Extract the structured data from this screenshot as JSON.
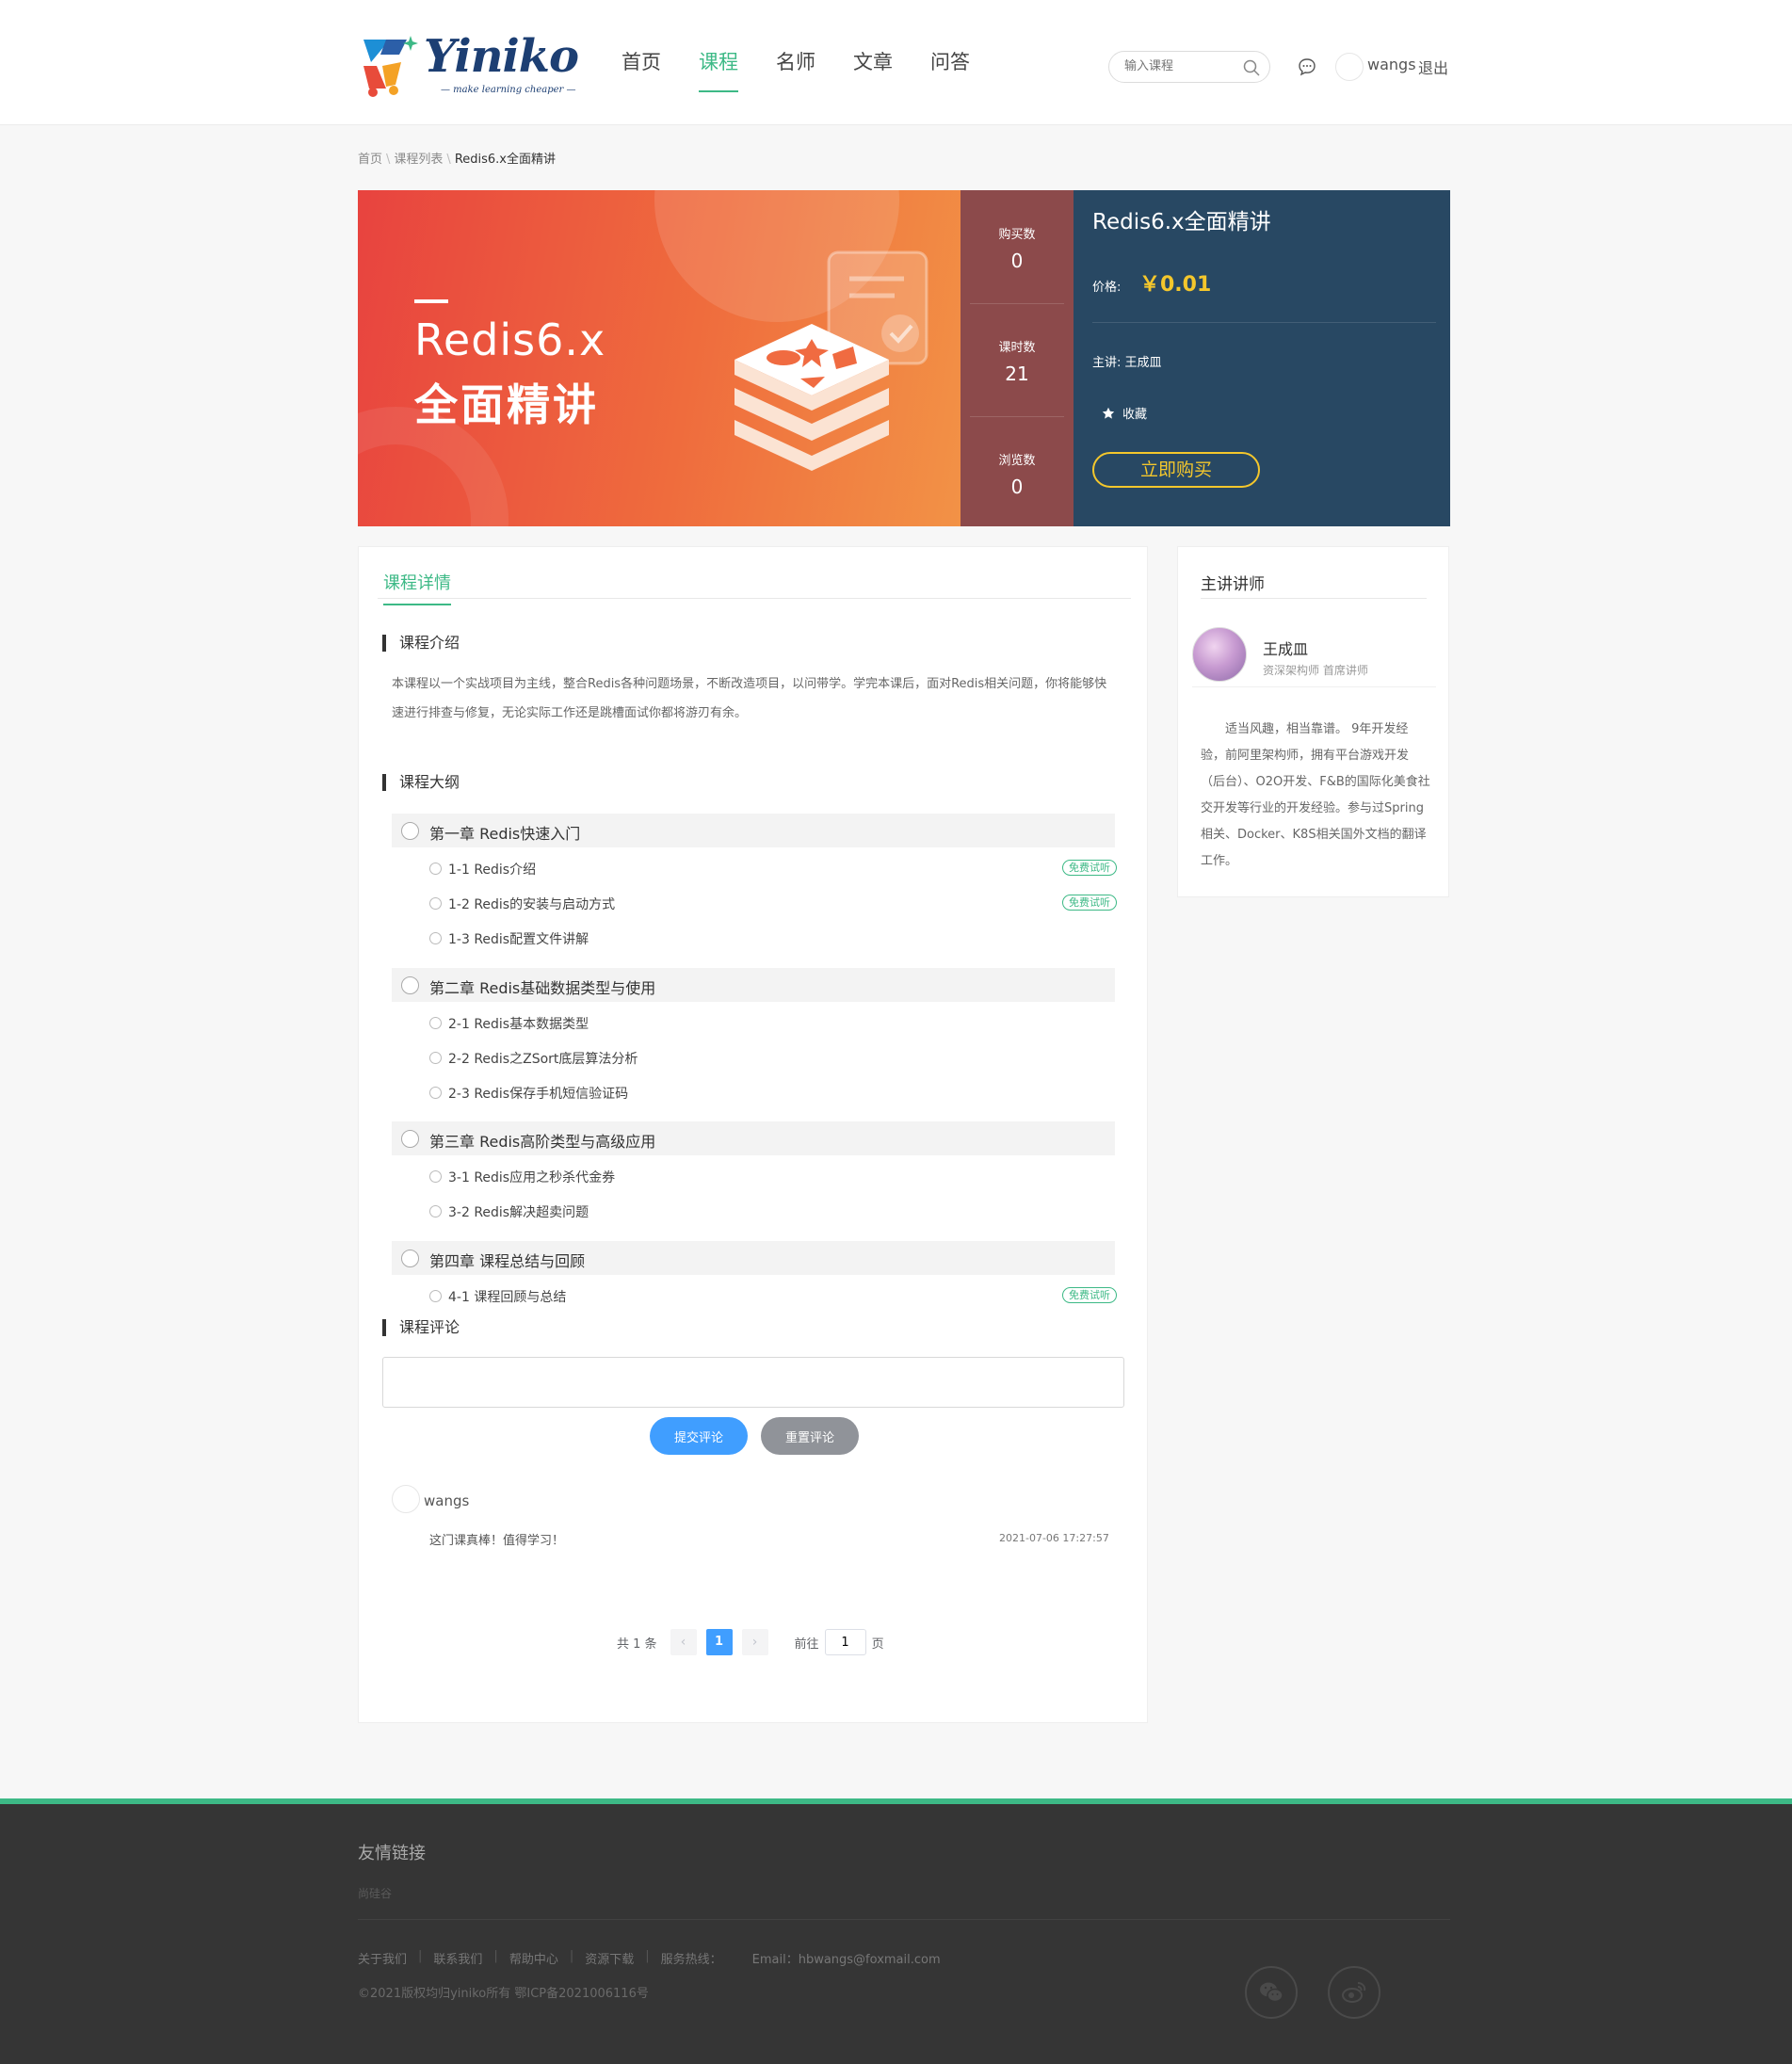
{
  "brand": {
    "logo_text": "Yiniko",
    "tagline": "— make learning cheaper —",
    "accent": "#3db986",
    "navy": "#1d3f73"
  },
  "nav": [
    {
      "label": "首页",
      "active": false
    },
    {
      "label": "课程",
      "active": true
    },
    {
      "label": "名师",
      "active": false
    },
    {
      "label": "文章",
      "active": false
    },
    {
      "label": "问答",
      "active": false
    }
  ],
  "header": {
    "search_placeholder": "输入课程",
    "search_icon": "search-icon",
    "message_icon": "chat-bubble-icon",
    "user": "wangs",
    "logout": "退出"
  },
  "breadcrumb": {
    "home": "首页",
    "list": "课程列表",
    "current": "Redis6.x全面精讲"
  },
  "banner": {
    "line1": "Redis6.x",
    "line2": "全面精讲",
    "gradient": [
      "#e8433f",
      "#f29246"
    ]
  },
  "stats": [
    {
      "label": "购买数",
      "value": "0"
    },
    {
      "label": "课时数",
      "value": "21"
    },
    {
      "label": "浏览数",
      "value": "0"
    }
  ],
  "course": {
    "title": "Redis6.x全面精讲",
    "price_label": "价格:",
    "price": "￥0.01",
    "teacher_label": "主讲:",
    "teacher": "王成皿",
    "favorite": "收藏",
    "buy": "立即购买",
    "panel_color": "#284863",
    "price_color": "#f4c72c"
  },
  "detail": {
    "tab": "课程详情",
    "intro_title": "课程介绍",
    "intro_text": "本课程以一个实战项目为主线，整合Redis各种问题场景，不断改造项目，以问带学。学完本课后，面对Redis相关问题，你将能够快速进行排查与修复，无论实际工作还是跳槽面试你都将游刃有余。",
    "outline_title": "课程大纲",
    "free_label": "免费试听",
    "chapters": [
      {
        "label": "第一章 Redis快速入门",
        "lessons": [
          {
            "label": "1-1 Redis介绍",
            "free": true
          },
          {
            "label": "1-2 Redis的安装与启动方式",
            "free": true
          },
          {
            "label": "1-3 Redis配置文件讲解",
            "free": false
          }
        ]
      },
      {
        "label": "第二章 Redis基础数据类型与使用",
        "lessons": [
          {
            "label": "2-1 Redis基本数据类型",
            "free": false
          },
          {
            "label": "2-2 Redis之ZSort底层算法分析",
            "free": false
          },
          {
            "label": "2-3 Redis保存手机短信验证码",
            "free": false
          }
        ]
      },
      {
        "label": "第三章 Redis高阶类型与高级应用",
        "lessons": [
          {
            "label": "3-1 Redis应用之秒杀代金券",
            "free": false
          },
          {
            "label": "3-2 Redis解决超卖问题",
            "free": false
          }
        ]
      },
      {
        "label": "第四章 课程总结与回顾",
        "lessons": [
          {
            "label": "4-1 课程回顾与总结",
            "free": true
          }
        ]
      }
    ],
    "comment_title": "课程评论",
    "comment_value": "",
    "submit": "提交评论",
    "reset": "重置评论",
    "comments": [
      {
        "user": "wangs",
        "text": "这门课真棒！值得学习！",
        "time": "2021-07-06 17:27:57"
      }
    ],
    "pager": {
      "total": "共 1 条",
      "prev": "‹",
      "current": "1",
      "next": "›",
      "goto": "前往",
      "page_value": "1",
      "page_unit": "页"
    }
  },
  "sidebar": {
    "title": "主讲讲师",
    "name": "王成皿",
    "role": "资深架构师   首席讲师",
    "bio": "适当风趣，相当靠谱。 9年开发经验，前阿里架构师，拥有平台游戏开发（后台）、O2O开发、F&B的国际化美食社交开发等行业的开发经验。参与过Spring相关、Docker、K8S相关国外文档的翻译工作。"
  },
  "footer": {
    "friend_title": "友情链接",
    "friend_link": "尚硅谷",
    "links": [
      "关于我们",
      "联系我们",
      "帮助中心",
      "资源下载",
      "服务热线："
    ],
    "email": "Email：hbwangs@foxmail.com",
    "copyright": "©2021版权均归yiniko所有 鄂ICP备2021006116号",
    "social": [
      "wechat-icon",
      "weibo-icon"
    ]
  }
}
